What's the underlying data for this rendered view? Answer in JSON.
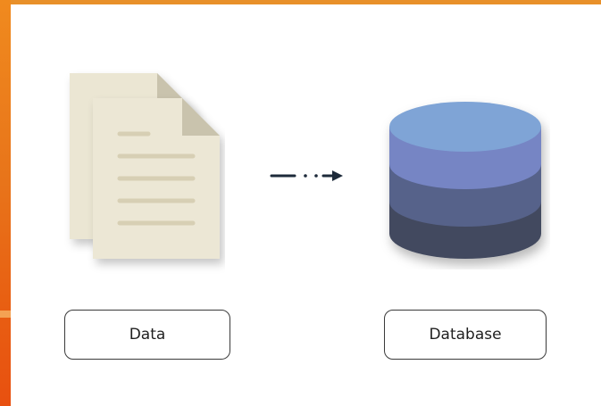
{
  "labels": {
    "data": "Data",
    "database": "Database"
  },
  "icons": {
    "source": "document-stack-icon",
    "connector": "dash-dot-arrow-icon",
    "target": "database-cylinder-icon"
  },
  "colors": {
    "accent_top": "#e8902a",
    "accent_side": "#e8741a",
    "paper": "#ebe6d3",
    "paper_fold": "#c9c3ad",
    "paper_lines": "#d7cfb4",
    "db_top": "#7fa4d6",
    "db_layer1": "#7685c4",
    "db_layer2": "#56628a",
    "db_layer3": "#434a5e",
    "arrow": "#1d2a3a"
  }
}
